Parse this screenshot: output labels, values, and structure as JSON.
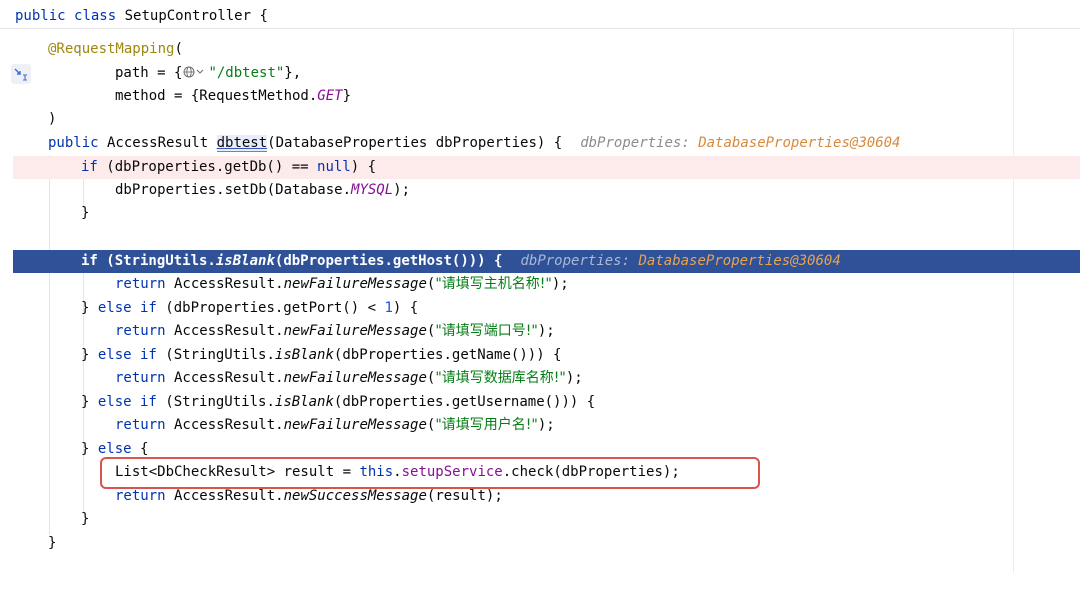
{
  "header": {
    "kw_public": "public",
    "kw_class": "class",
    "class_name": "SetupController",
    "brace": "{"
  },
  "code": {
    "annotation": "@RequestMapping",
    "paren_open": "(",
    "path_label": "path = {",
    "path_value": "\"/dbtest\"",
    "path_end": "},",
    "method_label": "method = {RequestMethod.",
    "method_value": "GET",
    "method_end": "}",
    "paren_close": ")",
    "sig_public": "public",
    "sig_type": " AccessResult ",
    "sig_name": "dbtest",
    "sig_params": "(DatabaseProperties dbProperties) {",
    "hint1_name": "dbProperties:",
    "hint1_value": " DatabaseProperties@30604",
    "if1_kw": "if",
    "if1_a": " (dbProperties.getDb() == ",
    "if1_null": "null",
    "if1_b": ") {",
    "set_a": "dbProperties.setDb(Database.",
    "set_const": "MYSQL",
    "set_b": ");",
    "close1": "}",
    "if2_kw": "if",
    "if2_a": " (StringUtils.",
    "if2_fn": "isBlank",
    "if2_b": "(dbProperties.getHost())) {",
    "hint2_name": "dbProperties:",
    "hint2_value": " DatabaseProperties@30604",
    "ret_kw": "return",
    "ret_cls": " AccessResult.",
    "ret_fail": "newFailureMessage",
    "ret1_str": "\"请填写主机名称!\"",
    "ret_end": ");",
    "ei1_close": "} ",
    "ei_else": "else",
    "ei_if": " if",
    "ei1_a": " (dbProperties.getPort() < ",
    "ei1_num": "1",
    "ei1_b": ") {",
    "ret2_str": "\"请填写端口号!\"",
    "ei2_a": " (StringUtils.",
    "ei2_fn": "isBlank",
    "ei2_b": "(dbProperties.getName())) {",
    "ret3_str": "\"请填写数据库名称!\"",
    "ei3_a": " (StringUtils.",
    "ei3_fn": "isBlank",
    "ei3_b": "(dbProperties.getUsername())) {",
    "ret4_str": "\"请填写用户名!\"",
    "else_close": "} ",
    "else_kw": "else",
    "else_brace": " {",
    "list_a": "List<DbCheckResult> result = ",
    "list_this": "this",
    "list_dot": ".",
    "list_field": "setupService",
    "list_b": ".check(dbProperties);",
    "ret_success": "newSuccessMessage",
    "ret_success_arg": "(result);",
    "close2": "}",
    "close3": "}"
  },
  "colors": {
    "keyword": "#0033b3",
    "string": "#067d17",
    "annotation": "#9e880d",
    "execution_line": "#2e5197",
    "error_line": "#fcebea",
    "highlight_box": "#d9534f"
  },
  "icons": {
    "globe": "globe-icon",
    "gutter": "step-into-icon"
  }
}
